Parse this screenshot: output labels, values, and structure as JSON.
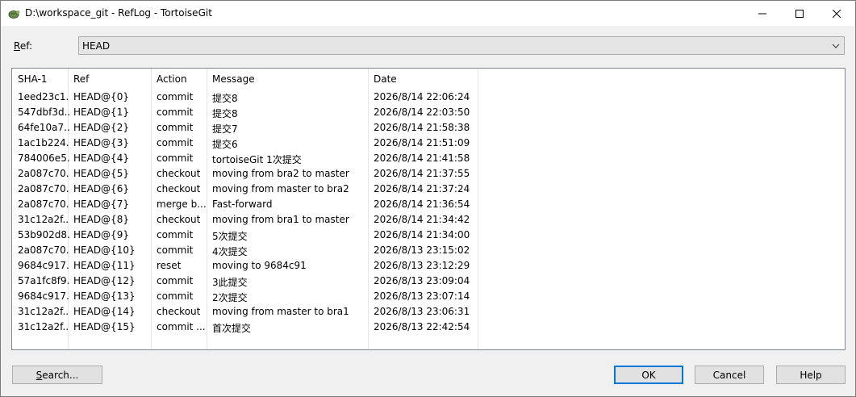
{
  "window": {
    "title": "D:\\workspace_git - RefLog - TortoiseGit"
  },
  "ref": {
    "label_mnemonic": "R",
    "label_rest": "ef:",
    "value": "HEAD"
  },
  "columns": [
    "SHA-1",
    "Ref",
    "Action",
    "Message",
    "Date"
  ],
  "rows": [
    {
      "sha": "1eed23c1...",
      "ref": "HEAD@{0}",
      "action": "commit",
      "message": "提交8",
      "date": "2026/8/14 22:06:24"
    },
    {
      "sha": "547dbf3d...",
      "ref": "HEAD@{1}",
      "action": "commit",
      "message": "提交8",
      "date": "2026/8/14 22:03:50"
    },
    {
      "sha": "64fe10a7...",
      "ref": "HEAD@{2}",
      "action": "commit",
      "message": "提交7",
      "date": "2026/8/14 21:58:38"
    },
    {
      "sha": "1ac1b224...",
      "ref": "HEAD@{3}",
      "action": "commit",
      "message": "提交6",
      "date": "2026/8/14 21:51:09"
    },
    {
      "sha": "784006e5...",
      "ref": "HEAD@{4}",
      "action": "commit",
      "message": "tortoiseGit 1次提交",
      "date": "2026/8/14 21:41:58"
    },
    {
      "sha": "2a087c70...",
      "ref": "HEAD@{5}",
      "action": "checkout",
      "message": "moving from bra2 to master",
      "date": "2026/8/14 21:37:55"
    },
    {
      "sha": "2a087c70...",
      "ref": "HEAD@{6}",
      "action": "checkout",
      "message": "moving from master to bra2",
      "date": "2026/8/14 21:37:24"
    },
    {
      "sha": "2a087c70...",
      "ref": "HEAD@{7}",
      "action": "merge b...",
      "message": "Fast-forward",
      "date": "2026/8/14 21:36:54"
    },
    {
      "sha": "31c12a2f...",
      "ref": "HEAD@{8}",
      "action": "checkout",
      "message": "moving from bra1 to master",
      "date": "2026/8/14 21:34:42"
    },
    {
      "sha": "53b902d8...",
      "ref": "HEAD@{9}",
      "action": "commit",
      "message": "5次提交",
      "date": "2026/8/14 21:34:00"
    },
    {
      "sha": "2a087c70...",
      "ref": "HEAD@{10}",
      "action": "commit",
      "message": "4次提交",
      "date": "2026/8/13 23:15:02"
    },
    {
      "sha": "9684c917...",
      "ref": "HEAD@{11}",
      "action": "reset",
      "message": "moving to 9684c91",
      "date": "2026/8/13 23:12:29"
    },
    {
      "sha": "57a1fc8f9...",
      "ref": "HEAD@{12}",
      "action": "commit",
      "message": "3此提交",
      "date": "2026/8/13 23:09:04"
    },
    {
      "sha": "9684c917...",
      "ref": "HEAD@{13}",
      "action": "commit",
      "message": "2次提交",
      "date": "2026/8/13 23:07:14"
    },
    {
      "sha": "31c12a2f...",
      "ref": "HEAD@{14}",
      "action": "checkout",
      "message": "moving from master to bra1",
      "date": "2026/8/13 23:06:31"
    },
    {
      "sha": "31c12a2f...",
      "ref": "HEAD@{15}",
      "action": "commit ...",
      "message": "首次提交",
      "date": "2026/8/13 22:42:54"
    }
  ],
  "buttons": {
    "search_mnemonic": "S",
    "search_rest": "earch...",
    "ok": "OK",
    "cancel": "Cancel",
    "help": "Help"
  },
  "icons": {
    "app": "tortoisegit-icon",
    "minimize": "minimize-icon",
    "maximize": "maximize-icon",
    "close": "close-icon",
    "dropdown": "chevron-down-icon"
  },
  "colors": {
    "title_bg": "#ffffff",
    "window_bg": "#f0f0f0",
    "default_button_border": "#0078d7"
  }
}
